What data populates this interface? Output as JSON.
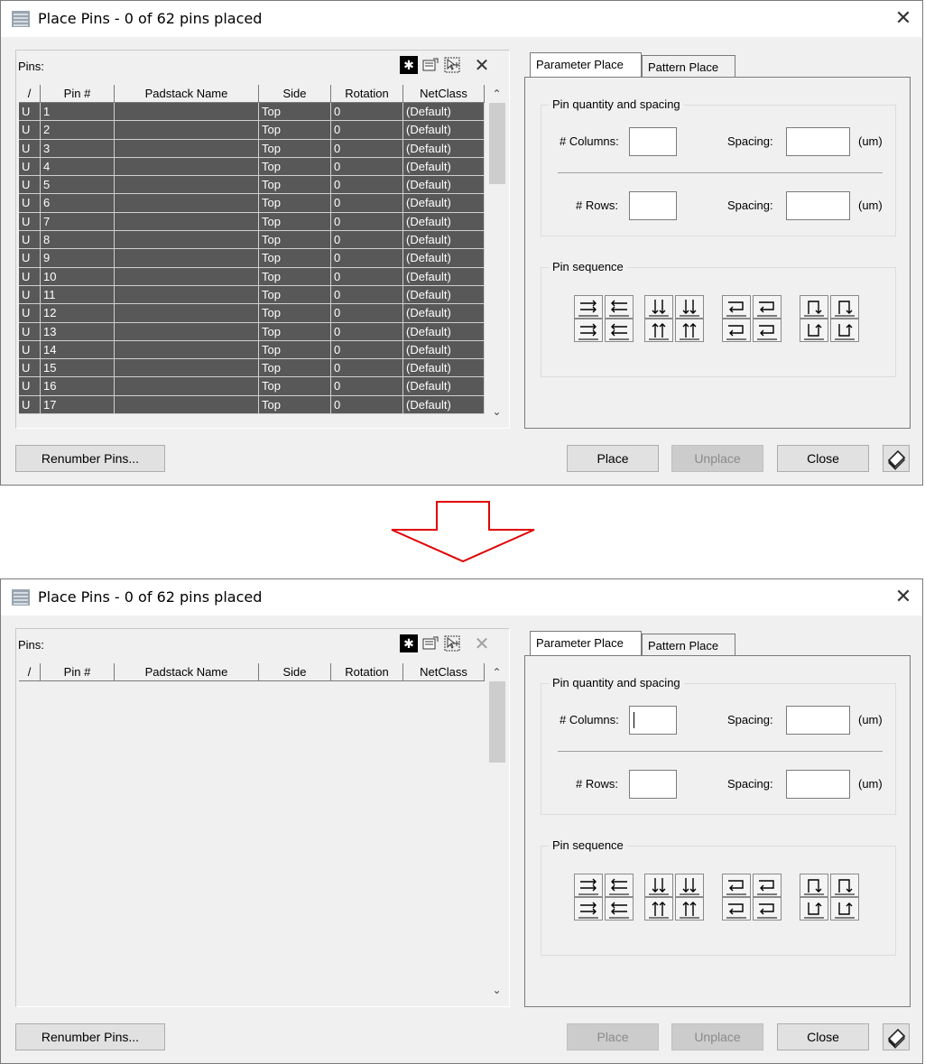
{
  "colors": {
    "rows_bg": "#585858",
    "arrow": "#e00000",
    "disabled_btn": "#cccccc"
  },
  "dialog_before": {
    "title": "Place Pins - 0 of 62 pins placed",
    "pins_label": "Pins:",
    "columns": [
      "/",
      "Pin #",
      "Padstack Name",
      "Side",
      "Rotation",
      "NetClass"
    ],
    "rows": [
      [
        "U",
        "1",
        "",
        "Top",
        "0",
        "(Default)"
      ],
      [
        "U",
        "2",
        "",
        "Top",
        "0",
        "(Default)"
      ],
      [
        "U",
        "3",
        "",
        "Top",
        "0",
        "(Default)"
      ],
      [
        "U",
        "4",
        "",
        "Top",
        "0",
        "(Default)"
      ],
      [
        "U",
        "5",
        "",
        "Top",
        "0",
        "(Default)"
      ],
      [
        "U",
        "6",
        "",
        "Top",
        "0",
        "(Default)"
      ],
      [
        "U",
        "7",
        "",
        "Top",
        "0",
        "(Default)"
      ],
      [
        "U",
        "8",
        "",
        "Top",
        "0",
        "(Default)"
      ],
      [
        "U",
        "9",
        "",
        "Top",
        "0",
        "(Default)"
      ],
      [
        "U",
        "10",
        "",
        "Top",
        "0",
        "(Default)"
      ],
      [
        "U",
        "11",
        "",
        "Top",
        "0",
        "(Default)"
      ],
      [
        "U",
        "12",
        "",
        "Top",
        "0",
        "(Default)"
      ],
      [
        "U",
        "13",
        "",
        "Top",
        "0",
        "(Default)"
      ],
      [
        "U",
        "14",
        "",
        "Top",
        "0",
        "(Default)"
      ],
      [
        "U",
        "15",
        "",
        "Top",
        "0",
        "(Default)"
      ],
      [
        "U",
        "16",
        "",
        "Top",
        "0",
        "(Default)"
      ],
      [
        "U",
        "17",
        "",
        "Top",
        "0",
        "(Default)"
      ]
    ],
    "tabs": [
      "Parameter Place",
      "Pattern Place"
    ],
    "group_qty": "Pin quantity and spacing",
    "columns_label": "# Columns:",
    "rows_label": "# Rows:",
    "spacing_label": "Spacing:",
    "unit": "(um)",
    "group_seq": "Pin sequence",
    "renumber": "Renumber Pins...",
    "place": "Place",
    "unplace": "Unplace",
    "close": "Close",
    "place_enabled": true
  },
  "dialog_after": {
    "title": "Place Pins - 0 of 62 pins placed",
    "pins_label": "Pins:",
    "columns": [
      "/",
      "Pin #",
      "Padstack Name",
      "Side",
      "Rotation",
      "NetClass"
    ],
    "tabs": [
      "Parameter Place",
      "Pattern Place"
    ],
    "group_qty": "Pin quantity and spacing",
    "columns_label": "# Columns:",
    "rows_label": "# Rows:",
    "spacing_label": "Spacing:",
    "unit": "(um)",
    "group_seq": "Pin sequence",
    "renumber": "Renumber Pins...",
    "place": "Place",
    "unplace": "Unplace",
    "close": "Close",
    "place_enabled": false
  }
}
